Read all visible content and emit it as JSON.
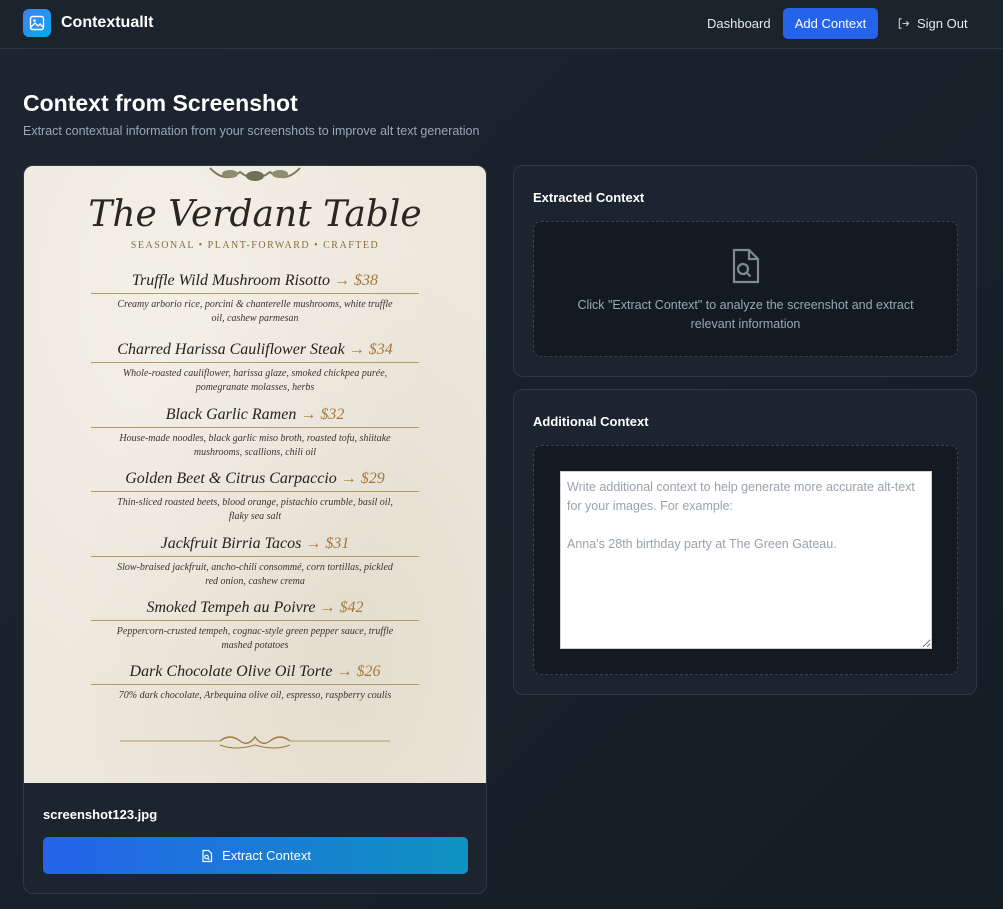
{
  "app": {
    "name": "ContextualIt",
    "nav": {
      "dashboard": "Dashboard",
      "add_context": "Add Context",
      "sign_out": "Sign Out"
    }
  },
  "page": {
    "title": "Context from Screenshot",
    "subtitle": "Extract contextual information from your screenshots to improve alt text generation"
  },
  "screenshot": {
    "filename": "screenshot123.jpg",
    "extract_button": "Extract Context",
    "menu": {
      "title": "The Verdant Table",
      "subtitle": "SEASONAL • PLANT-FORWARD • CRAFTED",
      "items": [
        {
          "name": "Truffle Wild Mushroom Risotto",
          "price": "→ $38",
          "desc": "Creamy arborio rice, porcini & chanterelle mushrooms, white truffle oil, cashew parmesan"
        },
        {
          "name": "Charred Harissa Cauliflower Steak",
          "price": "→ $34",
          "desc": "Whole-roasted cauliflower, harissa glaze, smoked chickpea purée, pomegranate molasses, herbs"
        },
        {
          "name": "Black Garlic Ramen",
          "price": "→ $32",
          "desc": "House-made noodles, black garlic miso broth, roasted tofu, shiitake mushrooms, scallions, chili oil"
        },
        {
          "name": "Golden Beet & Citrus Carpaccio",
          "price": "→ $29",
          "desc": "Thin-sliced roasted beets, blood orange, pistachio crumble, basil oil, flaky sea salt"
        },
        {
          "name": "Jackfruit Birria Tacos",
          "price": "→ $31",
          "desc": "Slow-braised jackfruit, ancho-chili consommé, corn tortillas, pickled red onion, cashew crema"
        },
        {
          "name": "Smoked Tempeh au Poivre",
          "price": "→ $42",
          "desc": "Peppercorn-crusted tempeh, cognac-style green pepper sauce, truffle mashed potatoes"
        },
        {
          "name": "Dark Chocolate Olive Oil Torte",
          "price": "→ $26",
          "desc": "70% dark chocolate, Arbequina olive oil, espresso, raspberry coulis"
        }
      ]
    }
  },
  "extracted": {
    "title": "Extracted Context",
    "placeholder": "Click \"Extract Context\" to analyze the screenshot and extract relevant information"
  },
  "additional": {
    "title": "Additional Context",
    "placeholder": "Write additional context to help generate more accurate alt-text for your images. For example:\n\nAnna's 28th birthday party at The Green Gateau."
  },
  "colors": {
    "accent": "#2563eb",
    "accent_end": "#0e93c0",
    "background": "#18212b"
  }
}
